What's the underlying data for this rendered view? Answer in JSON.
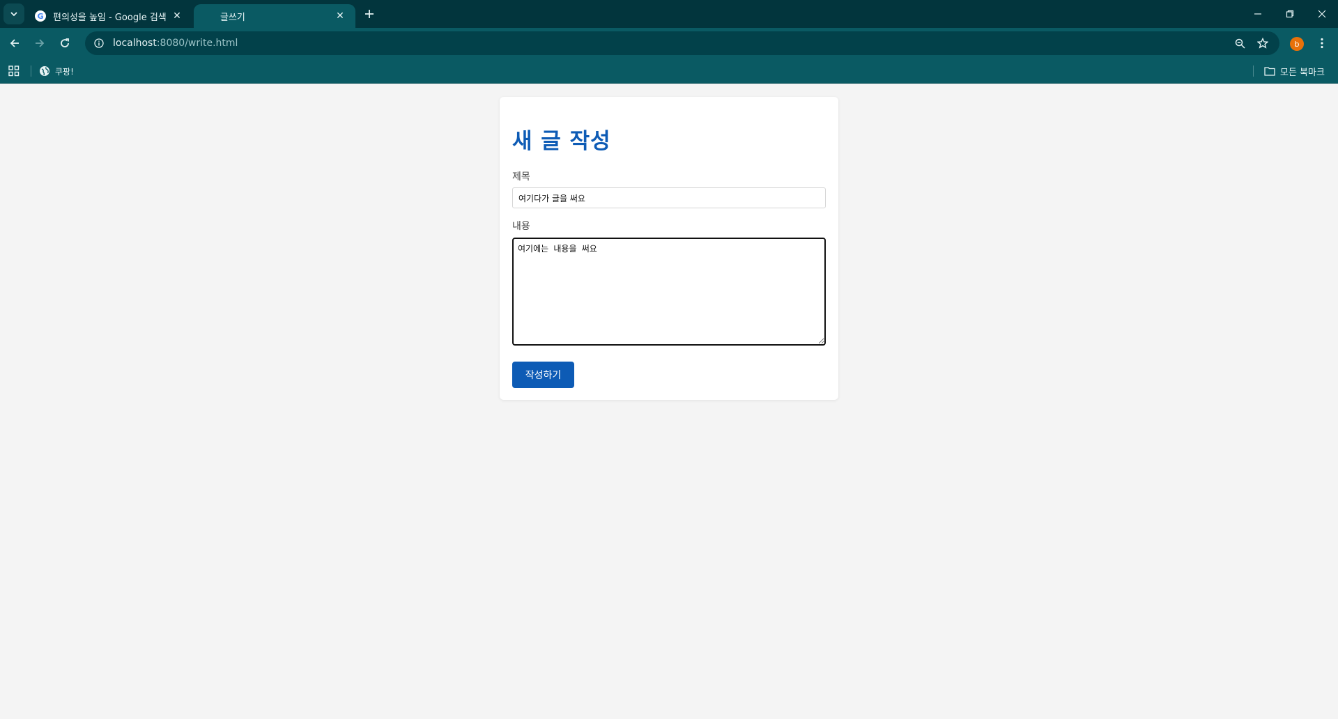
{
  "browser": {
    "tabs": [
      {
        "title": "편의성을 높임 - Google 검색",
        "favicon": "G"
      },
      {
        "title": "글쓰기"
      }
    ],
    "url_host": "localhost",
    "url_rest": ":8080/write.html",
    "profile_initial": "b",
    "bookmarks": [
      {
        "label": "쿠팡!"
      }
    ],
    "all_bookmarks_label": "모든 북마크"
  },
  "page": {
    "heading": "새 글 작성",
    "title_label": "제목",
    "title_value": "여기다가 글을 써요",
    "content_label": "내용",
    "content_value": "여기에는 내용을 써요",
    "submit_label": "작성하기"
  },
  "colors": {
    "accent": "#0d5bb5",
    "chrome_dark": "#02353d",
    "chrome": "#0a5a63",
    "avatar": "#e8710a"
  }
}
